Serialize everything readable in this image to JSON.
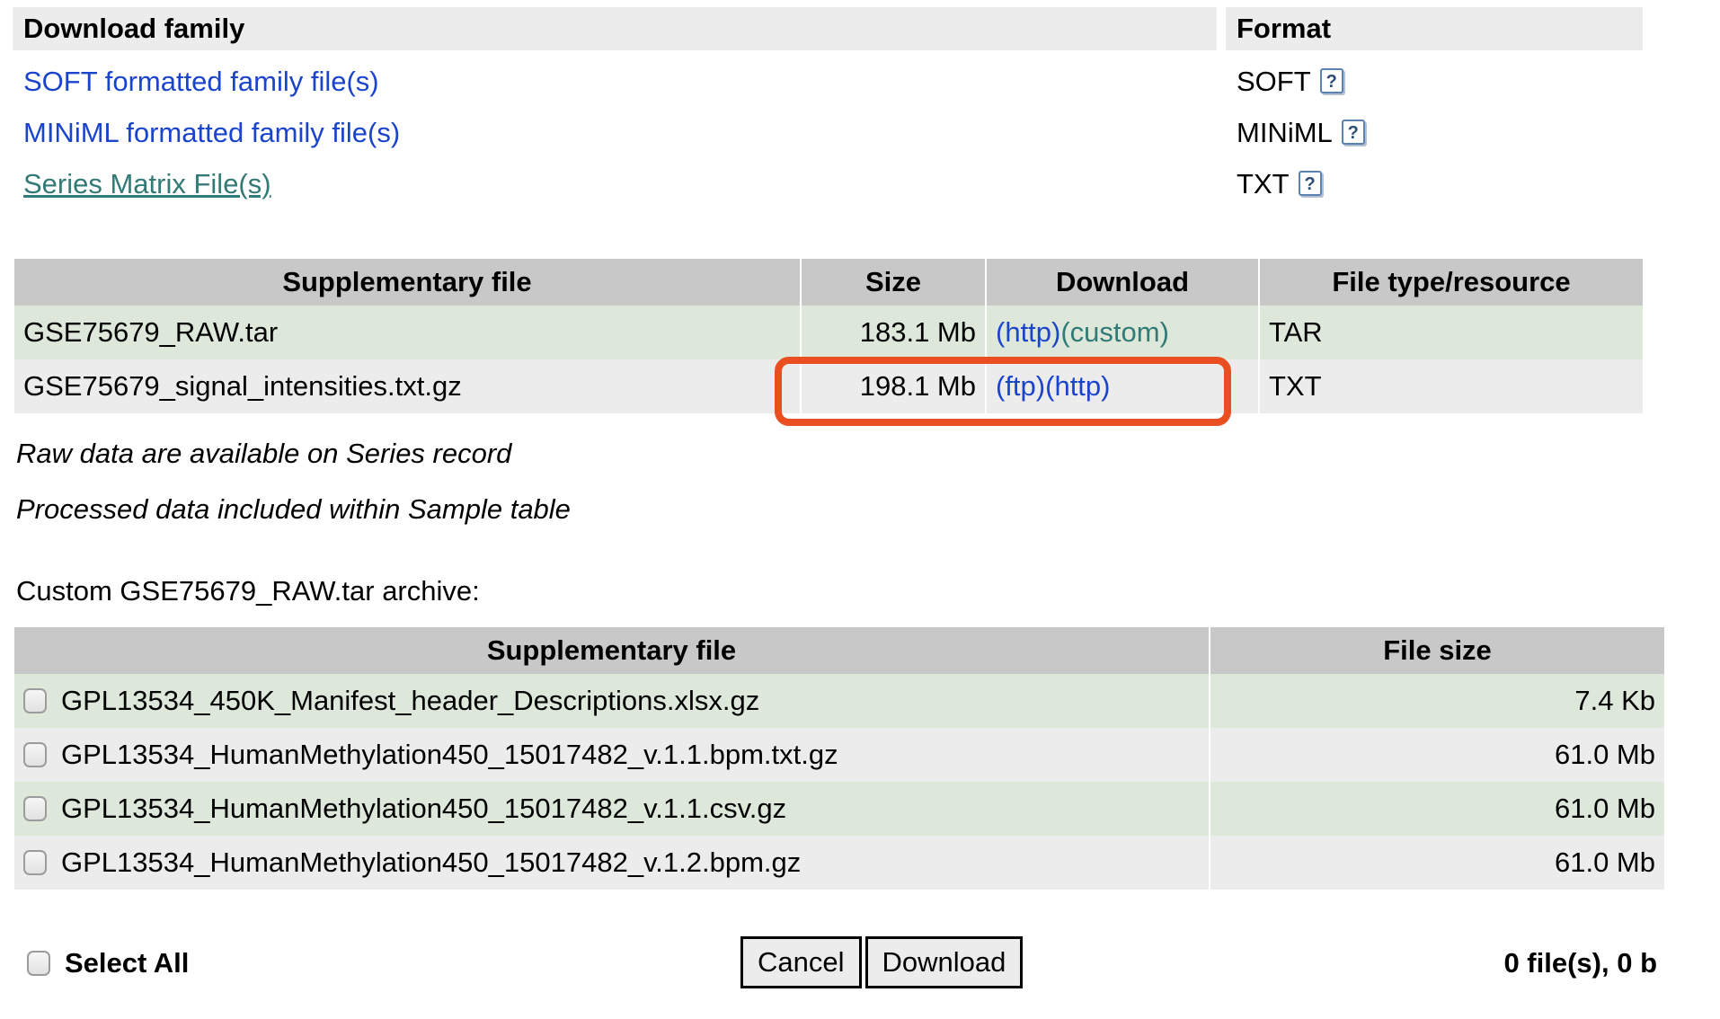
{
  "family": {
    "header": {
      "download_family_label": "Download family",
      "format_label": "Format"
    },
    "rows": [
      {
        "name": "SOFT formatted family file(s)",
        "format": "SOFT",
        "link_style": "blue",
        "help_icon": "help-icon"
      },
      {
        "name": "MINiML formatted family file(s)",
        "format": "MINiML",
        "link_style": "blue",
        "help_icon": "help-icon"
      },
      {
        "name": "Series Matrix File(s)",
        "format": "TXT",
        "link_style": "teal",
        "help_icon": "help-icon"
      }
    ]
  },
  "supplementary_table": {
    "columns": [
      "Supplementary file",
      "Size",
      "Download",
      "File type/resource"
    ],
    "rows": [
      {
        "file": "GSE75679_RAW.tar",
        "size": "183.1 Mb",
        "download": [
          {
            "label": "(http)",
            "color": "blue"
          },
          {
            "label": "(custom)",
            "color": "teal"
          }
        ],
        "type": "TAR"
      },
      {
        "file": "GSE75679_signal_intensities.txt.gz",
        "size": "198.1 Mb",
        "download": [
          {
            "label": "(ftp)",
            "color": "blue"
          },
          {
            "label": "(http)",
            "color": "blue"
          }
        ],
        "type": "TXT"
      }
    ]
  },
  "notes": [
    "Raw data are available on Series record",
    "Processed data included within Sample table"
  ],
  "custom_archive": {
    "title": "Custom GSE75679_RAW.tar archive:",
    "columns": [
      "Supplementary file",
      "File size"
    ],
    "rows": [
      {
        "file": "GPL13534_450K_Manifest_header_Descriptions.xlsx.gz",
        "size": "7.4 Kb",
        "checked": false
      },
      {
        "file": "GPL13534_HumanMethylation450_15017482_v.1.1.bpm.txt.gz",
        "size": "61.0 Mb",
        "checked": false
      },
      {
        "file": "GPL13534_HumanMethylation450_15017482_v.1.1.csv.gz",
        "size": "61.0 Mb",
        "checked": false
      },
      {
        "file": "GPL13534_HumanMethylation450_15017482_v.1.2.bpm.gz",
        "size": "61.0 Mb",
        "checked": false
      }
    ]
  },
  "footer": {
    "select_all_label": "Select All",
    "cancel_label": "Cancel",
    "download_label": "Download",
    "file_count": "0 file(s), 0 b"
  },
  "colors": {
    "link_blue": "#1a44cc",
    "link_teal": "#327a76",
    "header_grey": "#c8c8c8",
    "row_green": "#dde8da",
    "row_grey": "#ececec",
    "highlight_orange": "#ea4f22"
  },
  "annotation": {
    "highlight_target": "size-and-download-cells-row-2"
  }
}
